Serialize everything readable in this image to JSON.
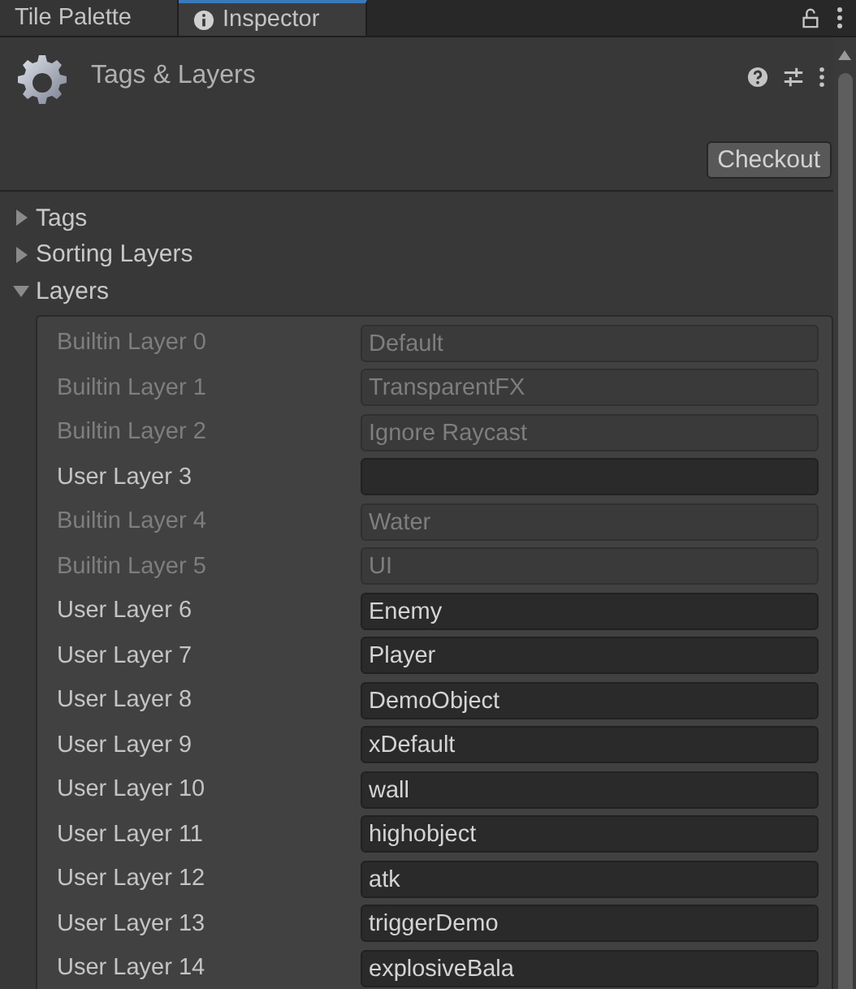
{
  "tabs": [
    {
      "label": "Tile Palette",
      "selected": false,
      "icon": false
    },
    {
      "label": "Inspector",
      "selected": true,
      "icon": true
    }
  ],
  "header": {
    "title": "Tags & Layers",
    "button": "Checkout"
  },
  "sections": [
    {
      "label": "Tags",
      "expanded": false
    },
    {
      "label": "Sorting Layers",
      "expanded": false
    },
    {
      "label": "Layers",
      "expanded": true
    }
  ],
  "layers": [
    {
      "label": "Builtin Layer 0",
      "value": "Default",
      "disabled": true
    },
    {
      "label": "Builtin Layer 1",
      "value": "TransparentFX",
      "disabled": true
    },
    {
      "label": "Builtin Layer 2",
      "value": "Ignore Raycast",
      "disabled": true
    },
    {
      "label": "User Layer 3",
      "disabled": false
    },
    {
      "label": "Builtin Layer 4",
      "value": "Water",
      "disabled": true
    },
    {
      "label": "Builtin Layer 5",
      "value": "UI",
      "disabled": true
    },
    {
      "label": "User Layer 6",
      "value": "Enemy",
      "disabled": false
    },
    {
      "label": "User Layer 7",
      "value": "Player",
      "disabled": false
    },
    {
      "label": "User Layer 8",
      "value": "DemoObject",
      "disabled": false
    },
    {
      "label": "User Layer 9",
      "value": "xDefault",
      "disabled": false
    },
    {
      "label": "User Layer 10",
      "value": "wall",
      "disabled": false
    },
    {
      "label": "User Layer 11",
      "value": "highobject",
      "disabled": false
    },
    {
      "label": "User Layer 12",
      "value": "atk",
      "disabled": false
    },
    {
      "label": "User Layer 13",
      "value": "triggerDemo",
      "disabled": false
    },
    {
      "label": "User Layer 14",
      "value": "explosiveBala",
      "disabled": false
    }
  ]
}
